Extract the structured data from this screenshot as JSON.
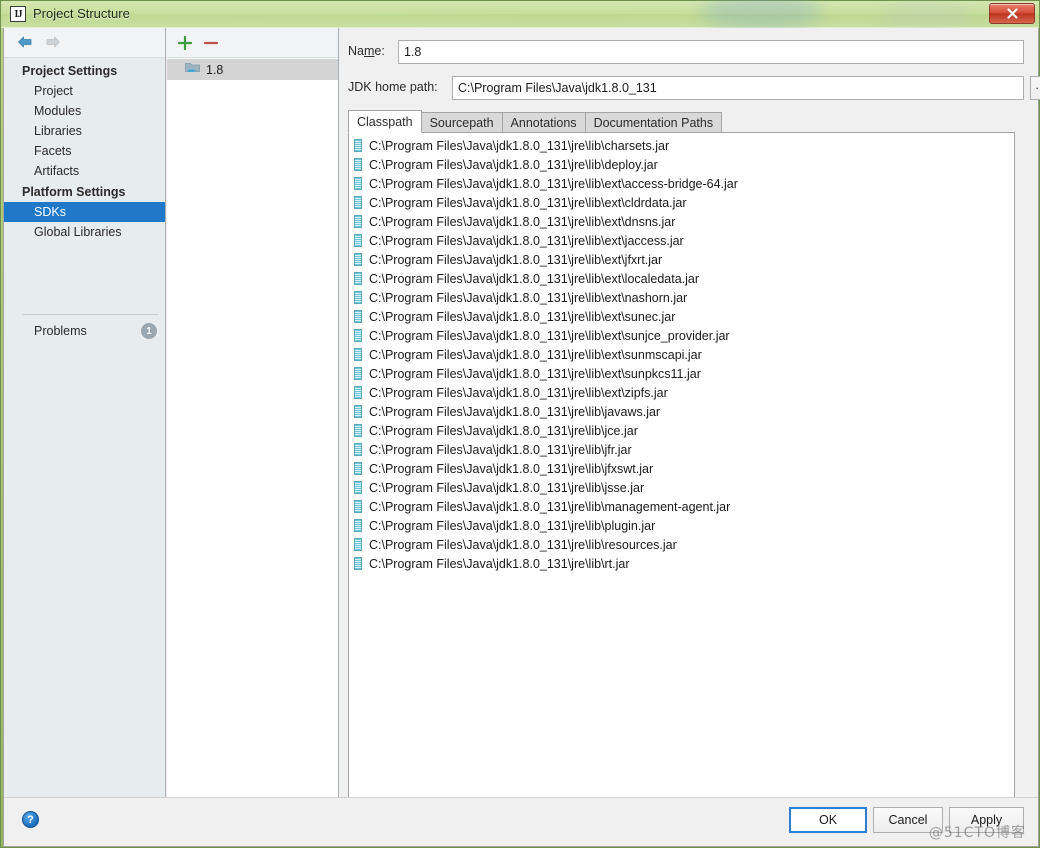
{
  "window": {
    "title": "Project Structure",
    "app_icon": "intellij-idea-icon",
    "close_label": "✕"
  },
  "nav": {
    "back_icon": "arrow-left-icon",
    "forward_icon": "arrow-right-icon"
  },
  "sidebar": {
    "groups": [
      {
        "label": "Project Settings",
        "items": [
          {
            "label": "Project",
            "selected": false
          },
          {
            "label": "Modules",
            "selected": false
          },
          {
            "label": "Libraries",
            "selected": false
          },
          {
            "label": "Facets",
            "selected": false
          },
          {
            "label": "Artifacts",
            "selected": false
          }
        ]
      },
      {
        "label": "Platform Settings",
        "items": [
          {
            "label": "SDKs",
            "selected": true
          },
          {
            "label": "Global Libraries",
            "selected": false
          }
        ]
      }
    ],
    "problems": {
      "label": "Problems",
      "count": "1"
    }
  },
  "tree_panel": {
    "toolbar": {
      "add_label": "+",
      "remove_label": "−"
    },
    "items": [
      {
        "label": "1.8",
        "icon": "jdk-folder-icon",
        "selected": true
      }
    ]
  },
  "content": {
    "name_field": {
      "label_prefix": "Na",
      "label_accel": "m",
      "label_suffix": "e:",
      "value": "1.8"
    },
    "jdk_home_field": {
      "label": "JDK home path:",
      "value": "C:\\Program Files\\Java\\jdk1.8.0_131",
      "browse_label": "..."
    },
    "tabs": [
      {
        "label": "Classpath",
        "active": true
      },
      {
        "label": "Sourcepath",
        "active": false
      },
      {
        "label": "Annotations",
        "active": false
      },
      {
        "label": "Documentation Paths",
        "active": false
      }
    ],
    "classpath_entries": [
      "C:\\Program Files\\Java\\jdk1.8.0_131\\jre\\lib\\charsets.jar",
      "C:\\Program Files\\Java\\jdk1.8.0_131\\jre\\lib\\deploy.jar",
      "C:\\Program Files\\Java\\jdk1.8.0_131\\jre\\lib\\ext\\access-bridge-64.jar",
      "C:\\Program Files\\Java\\jdk1.8.0_131\\jre\\lib\\ext\\cldrdata.jar",
      "C:\\Program Files\\Java\\jdk1.8.0_131\\jre\\lib\\ext\\dnsns.jar",
      "C:\\Program Files\\Java\\jdk1.8.0_131\\jre\\lib\\ext\\jaccess.jar",
      "C:\\Program Files\\Java\\jdk1.8.0_131\\jre\\lib\\ext\\jfxrt.jar",
      "C:\\Program Files\\Java\\jdk1.8.0_131\\jre\\lib\\ext\\localedata.jar",
      "C:\\Program Files\\Java\\jdk1.8.0_131\\jre\\lib\\ext\\nashorn.jar",
      "C:\\Program Files\\Java\\jdk1.8.0_131\\jre\\lib\\ext\\sunec.jar",
      "C:\\Program Files\\Java\\jdk1.8.0_131\\jre\\lib\\ext\\sunjce_provider.jar",
      "C:\\Program Files\\Java\\jdk1.8.0_131\\jre\\lib\\ext\\sunmscapi.jar",
      "C:\\Program Files\\Java\\jdk1.8.0_131\\jre\\lib\\ext\\sunpkcs11.jar",
      "C:\\Program Files\\Java\\jdk1.8.0_131\\jre\\lib\\ext\\zipfs.jar",
      "C:\\Program Files\\Java\\jdk1.8.0_131\\jre\\lib\\javaws.jar",
      "C:\\Program Files\\Java\\jdk1.8.0_131\\jre\\lib\\jce.jar",
      "C:\\Program Files\\Java\\jdk1.8.0_131\\jre\\lib\\jfr.jar",
      "C:\\Program Files\\Java\\jdk1.8.0_131\\jre\\lib\\jfxswt.jar",
      "C:\\Program Files\\Java\\jdk1.8.0_131\\jre\\lib\\jsse.jar",
      "C:\\Program Files\\Java\\jdk1.8.0_131\\jre\\lib\\management-agent.jar",
      "C:\\Program Files\\Java\\jdk1.8.0_131\\jre\\lib\\plugin.jar",
      "C:\\Program Files\\Java\\jdk1.8.0_131\\jre\\lib\\resources.jar",
      "C:\\Program Files\\Java\\jdk1.8.0_131\\jre\\lib\\rt.jar"
    ],
    "list_toolbar": {
      "add_label": "+",
      "remove_label": "−"
    }
  },
  "footer": {
    "help_label": "?",
    "ok_label": "OK",
    "cancel_label": "Cancel",
    "apply_label": "Apply"
  },
  "watermark": "@51CTO博客",
  "colors": {
    "accent_blue": "#1f78c8",
    "add_green": "#3d9c3d",
    "remove_red": "#c0504d",
    "title_green": "#c8df9e",
    "default_button_border": "#2a7fd4"
  }
}
